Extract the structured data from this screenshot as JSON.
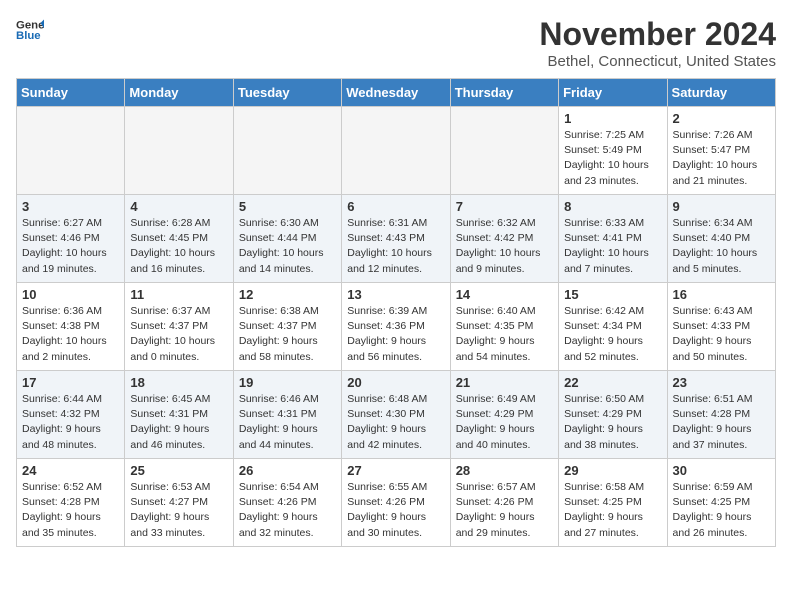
{
  "header": {
    "logo_line1": "General",
    "logo_line2": "Blue",
    "month_title": "November 2024",
    "location": "Bethel, Connecticut, United States"
  },
  "days_of_week": [
    "Sunday",
    "Monday",
    "Tuesday",
    "Wednesday",
    "Thursday",
    "Friday",
    "Saturday"
  ],
  "weeks": [
    [
      {
        "day": "",
        "info": ""
      },
      {
        "day": "",
        "info": ""
      },
      {
        "day": "",
        "info": ""
      },
      {
        "day": "",
        "info": ""
      },
      {
        "day": "",
        "info": ""
      },
      {
        "day": "1",
        "info": "Sunrise: 7:25 AM\nSunset: 5:49 PM\nDaylight: 10 hours\nand 23 minutes."
      },
      {
        "day": "2",
        "info": "Sunrise: 7:26 AM\nSunset: 5:47 PM\nDaylight: 10 hours\nand 21 minutes."
      }
    ],
    [
      {
        "day": "3",
        "info": "Sunrise: 6:27 AM\nSunset: 4:46 PM\nDaylight: 10 hours\nand 19 minutes."
      },
      {
        "day": "4",
        "info": "Sunrise: 6:28 AM\nSunset: 4:45 PM\nDaylight: 10 hours\nand 16 minutes."
      },
      {
        "day": "5",
        "info": "Sunrise: 6:30 AM\nSunset: 4:44 PM\nDaylight: 10 hours\nand 14 minutes."
      },
      {
        "day": "6",
        "info": "Sunrise: 6:31 AM\nSunset: 4:43 PM\nDaylight: 10 hours\nand 12 minutes."
      },
      {
        "day": "7",
        "info": "Sunrise: 6:32 AM\nSunset: 4:42 PM\nDaylight: 10 hours\nand 9 minutes."
      },
      {
        "day": "8",
        "info": "Sunrise: 6:33 AM\nSunset: 4:41 PM\nDaylight: 10 hours\nand 7 minutes."
      },
      {
        "day": "9",
        "info": "Sunrise: 6:34 AM\nSunset: 4:40 PM\nDaylight: 10 hours\nand 5 minutes."
      }
    ],
    [
      {
        "day": "10",
        "info": "Sunrise: 6:36 AM\nSunset: 4:38 PM\nDaylight: 10 hours\nand 2 minutes."
      },
      {
        "day": "11",
        "info": "Sunrise: 6:37 AM\nSunset: 4:37 PM\nDaylight: 10 hours\nand 0 minutes."
      },
      {
        "day": "12",
        "info": "Sunrise: 6:38 AM\nSunset: 4:37 PM\nDaylight: 9 hours\nand 58 minutes."
      },
      {
        "day": "13",
        "info": "Sunrise: 6:39 AM\nSunset: 4:36 PM\nDaylight: 9 hours\nand 56 minutes."
      },
      {
        "day": "14",
        "info": "Sunrise: 6:40 AM\nSunset: 4:35 PM\nDaylight: 9 hours\nand 54 minutes."
      },
      {
        "day": "15",
        "info": "Sunrise: 6:42 AM\nSunset: 4:34 PM\nDaylight: 9 hours\nand 52 minutes."
      },
      {
        "day": "16",
        "info": "Sunrise: 6:43 AM\nSunset: 4:33 PM\nDaylight: 9 hours\nand 50 minutes."
      }
    ],
    [
      {
        "day": "17",
        "info": "Sunrise: 6:44 AM\nSunset: 4:32 PM\nDaylight: 9 hours\nand 48 minutes."
      },
      {
        "day": "18",
        "info": "Sunrise: 6:45 AM\nSunset: 4:31 PM\nDaylight: 9 hours\nand 46 minutes."
      },
      {
        "day": "19",
        "info": "Sunrise: 6:46 AM\nSunset: 4:31 PM\nDaylight: 9 hours\nand 44 minutes."
      },
      {
        "day": "20",
        "info": "Sunrise: 6:48 AM\nSunset: 4:30 PM\nDaylight: 9 hours\nand 42 minutes."
      },
      {
        "day": "21",
        "info": "Sunrise: 6:49 AM\nSunset: 4:29 PM\nDaylight: 9 hours\nand 40 minutes."
      },
      {
        "day": "22",
        "info": "Sunrise: 6:50 AM\nSunset: 4:29 PM\nDaylight: 9 hours\nand 38 minutes."
      },
      {
        "day": "23",
        "info": "Sunrise: 6:51 AM\nSunset: 4:28 PM\nDaylight: 9 hours\nand 37 minutes."
      }
    ],
    [
      {
        "day": "24",
        "info": "Sunrise: 6:52 AM\nSunset: 4:28 PM\nDaylight: 9 hours\nand 35 minutes."
      },
      {
        "day": "25",
        "info": "Sunrise: 6:53 AM\nSunset: 4:27 PM\nDaylight: 9 hours\nand 33 minutes."
      },
      {
        "day": "26",
        "info": "Sunrise: 6:54 AM\nSunset: 4:26 PM\nDaylight: 9 hours\nand 32 minutes."
      },
      {
        "day": "27",
        "info": "Sunrise: 6:55 AM\nSunset: 4:26 PM\nDaylight: 9 hours\nand 30 minutes."
      },
      {
        "day": "28",
        "info": "Sunrise: 6:57 AM\nSunset: 4:26 PM\nDaylight: 9 hours\nand 29 minutes."
      },
      {
        "day": "29",
        "info": "Sunrise: 6:58 AM\nSunset: 4:25 PM\nDaylight: 9 hours\nand 27 minutes."
      },
      {
        "day": "30",
        "info": "Sunrise: 6:59 AM\nSunset: 4:25 PM\nDaylight: 9 hours\nand 26 minutes."
      }
    ]
  ]
}
